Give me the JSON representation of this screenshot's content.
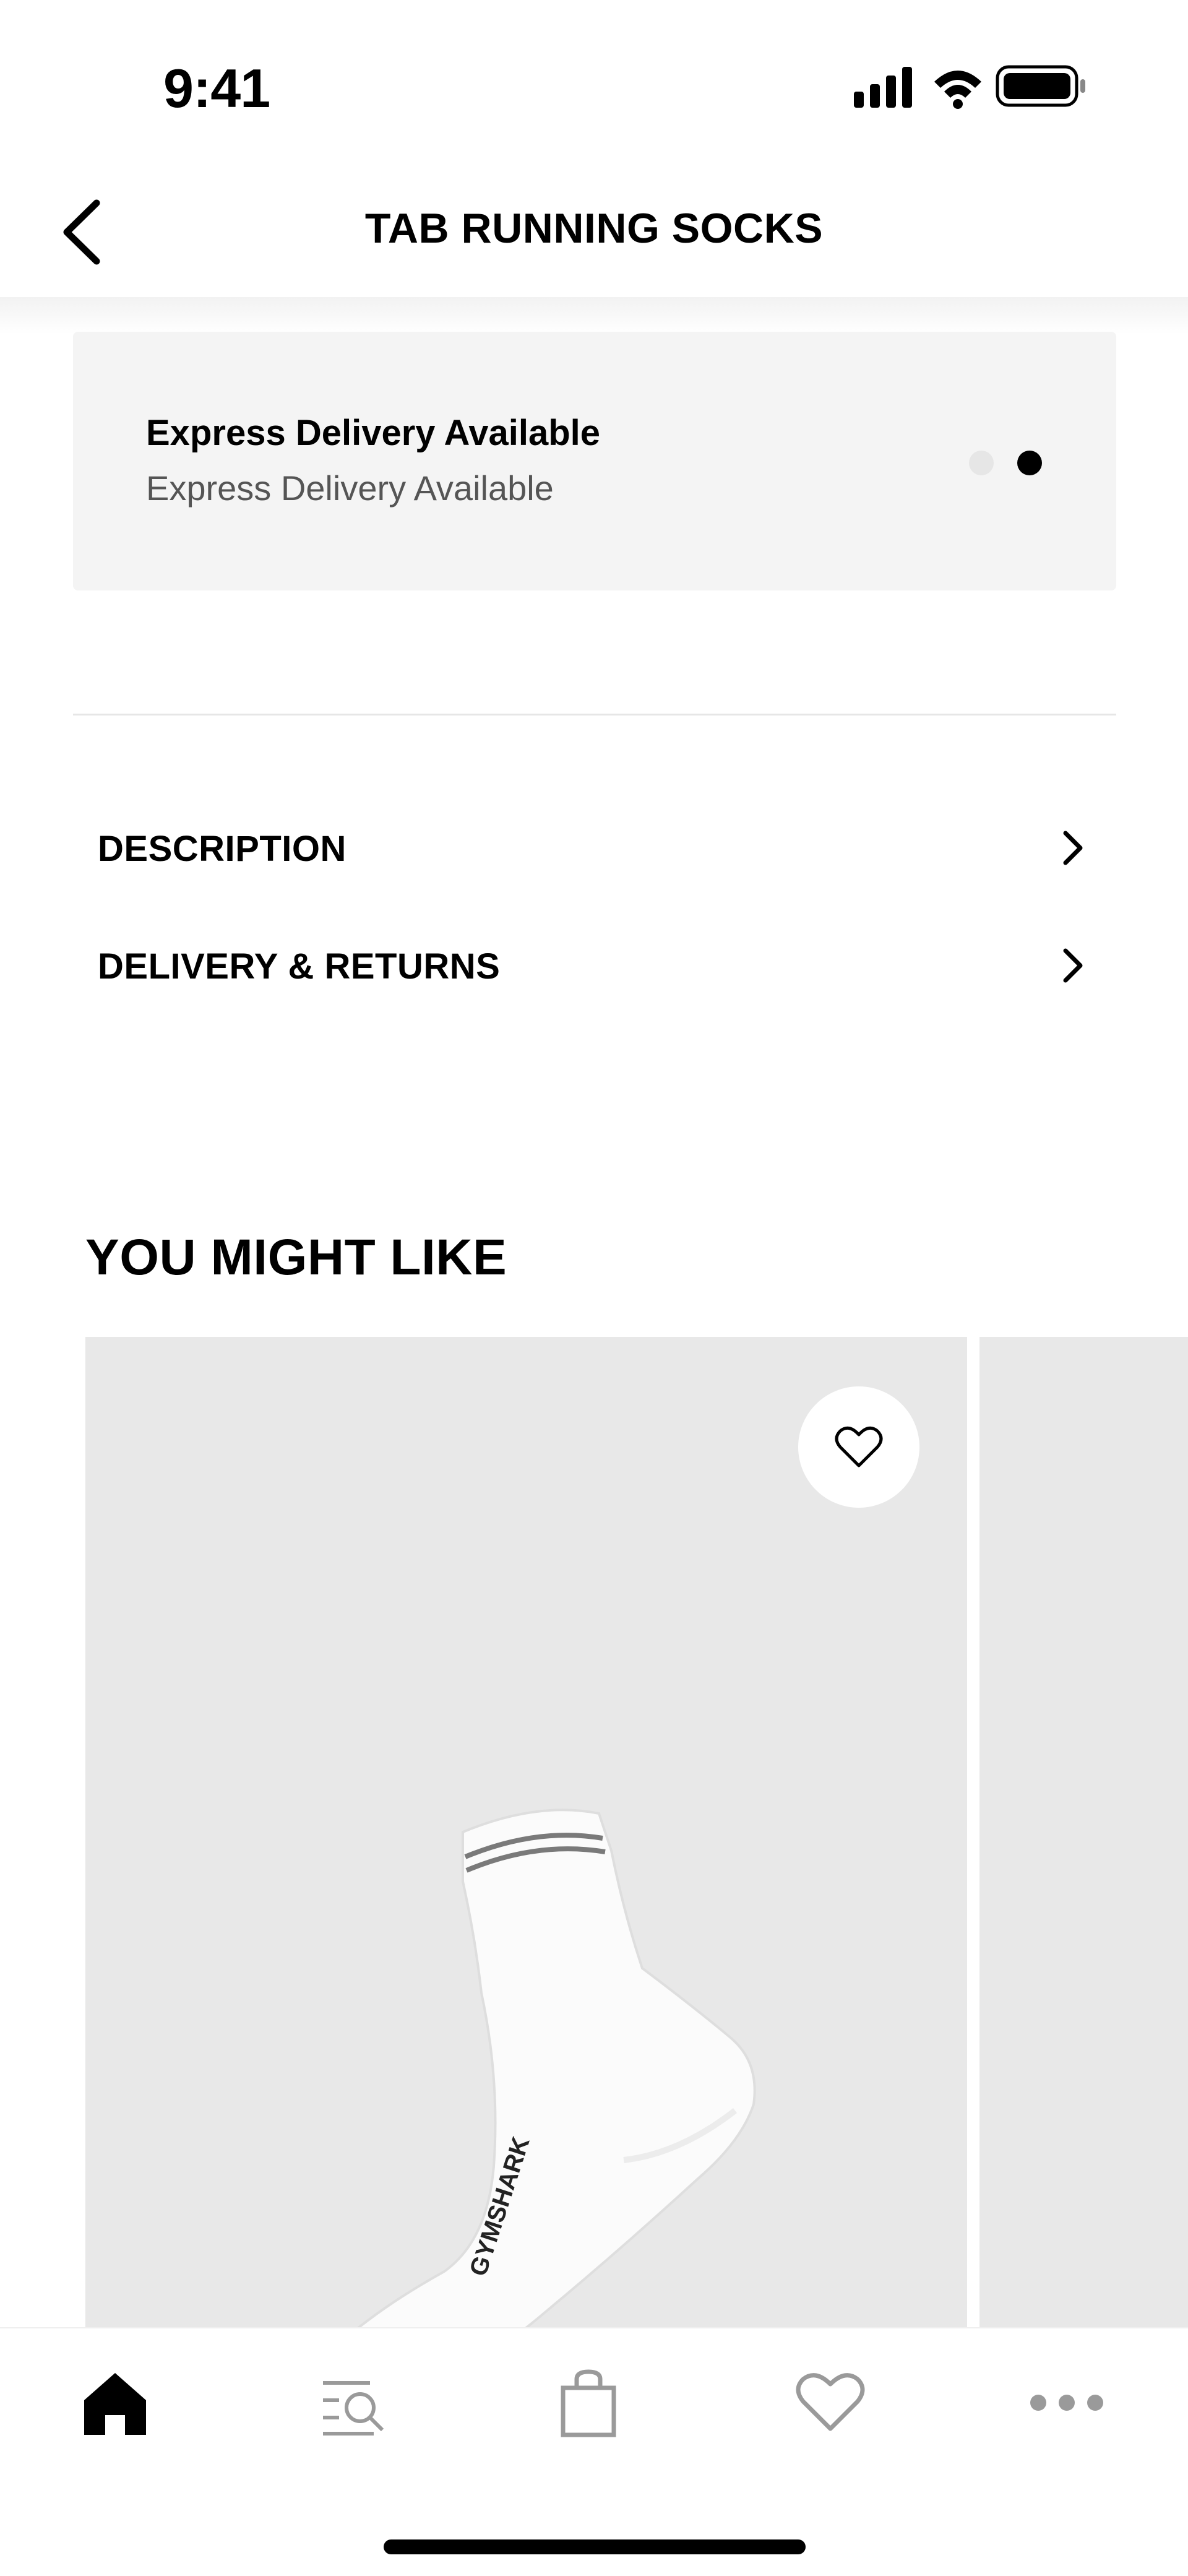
{
  "status_bar": {
    "time": "9:41"
  },
  "header": {
    "title": "TAB RUNNING SOCKS"
  },
  "delivery": {
    "title": "Express Delivery Available",
    "subtitle": "Express Delivery Available",
    "carousel_total": 2,
    "carousel_active_index": 1
  },
  "accordion": {
    "items": [
      {
        "label": "DESCRIPTION",
        "icon": "chevron-right-icon"
      },
      {
        "label": "DELIVERY & RETURNS",
        "icon": "chevron-right-icon"
      }
    ]
  },
  "recommendations": {
    "title": "YOU MIGHT LIKE",
    "products": [
      {
        "image": "white-crew-sock",
        "brand_on_sock": "GYMSHARK",
        "favorite_icon": "heart-outline-icon"
      }
    ]
  },
  "tab_bar": {
    "tabs": [
      {
        "icon": "home-icon",
        "active": true
      },
      {
        "icon": "search-icon",
        "active": false
      },
      {
        "icon": "bag-icon",
        "active": false
      },
      {
        "icon": "heart-icon",
        "active": false
      },
      {
        "icon": "more-icon",
        "active": false
      }
    ]
  },
  "colors": {
    "primary": "#000000",
    "card_bg": "#f4f4f4",
    "image_bg": "#e8e8e8",
    "inactive_icon": "#9a9a9a"
  }
}
